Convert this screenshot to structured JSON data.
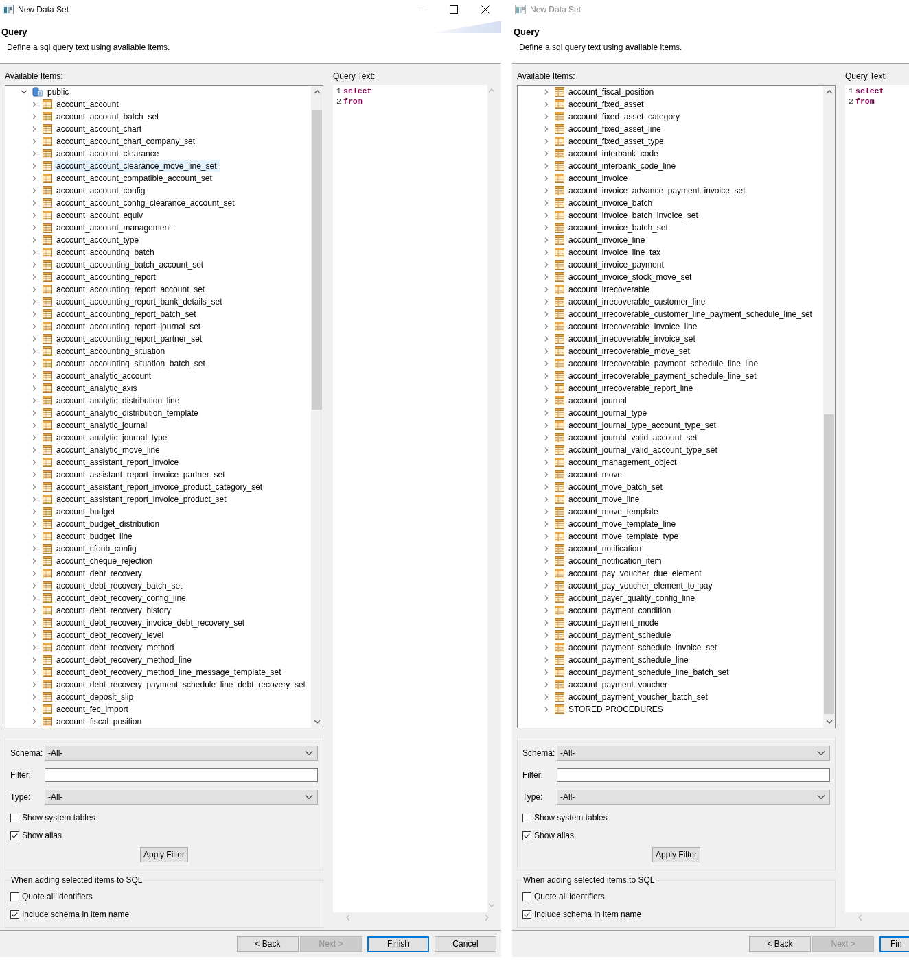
{
  "dialogs": [
    {
      "title": "New Data Set",
      "active": true,
      "window_controls": [
        {
          "kind": "minimize",
          "disabled": true
        },
        {
          "kind": "maximize",
          "disabled": false
        },
        {
          "kind": "close",
          "disabled": false
        }
      ],
      "header": {
        "title": "Query",
        "description": "Define a sql query text using available items."
      },
      "available_items_label": "Available Items:",
      "query_text_label": "Query Text:",
      "tree": [
        {
          "label": "public",
          "kind": "schema",
          "expanded": true,
          "selected": false,
          "children": [
            {
              "label": "account_account",
              "kind": "table",
              "expanded": false,
              "selected": false
            },
            {
              "label": "account_account_batch_set",
              "kind": "table",
              "expanded": false,
              "selected": false
            },
            {
              "label": "account_account_chart",
              "kind": "table",
              "expanded": false,
              "selected": false
            },
            {
              "label": "account_account_chart_company_set",
              "kind": "table",
              "expanded": false,
              "selected": false
            },
            {
              "label": "account_account_clearance",
              "kind": "table",
              "expanded": false,
              "selected": false
            },
            {
              "label": "account_account_clearance_move_line_set",
              "kind": "table",
              "expanded": false,
              "selected": true
            },
            {
              "label": "account_account_compatible_account_set",
              "kind": "table",
              "expanded": false,
              "selected": false
            },
            {
              "label": "account_account_config",
              "kind": "table",
              "expanded": false,
              "selected": false
            },
            {
              "label": "account_account_config_clearance_account_set",
              "kind": "table",
              "expanded": false,
              "selected": false
            },
            {
              "label": "account_account_equiv",
              "kind": "table",
              "expanded": false,
              "selected": false
            },
            {
              "label": "account_account_management",
              "kind": "table",
              "expanded": false,
              "selected": false
            },
            {
              "label": "account_account_type",
              "kind": "table",
              "expanded": false,
              "selected": false
            },
            {
              "label": "account_accounting_batch",
              "kind": "table",
              "expanded": false,
              "selected": false
            },
            {
              "label": "account_accounting_batch_account_set",
              "kind": "table",
              "expanded": false,
              "selected": false
            },
            {
              "label": "account_accounting_report",
              "kind": "table",
              "expanded": false,
              "selected": false
            },
            {
              "label": "account_accounting_report_account_set",
              "kind": "table",
              "expanded": false,
              "selected": false
            },
            {
              "label": "account_accounting_report_bank_details_set",
              "kind": "table",
              "expanded": false,
              "selected": false
            },
            {
              "label": "account_accounting_report_batch_set",
              "kind": "table",
              "expanded": false,
              "selected": false
            },
            {
              "label": "account_accounting_report_journal_set",
              "kind": "table",
              "expanded": false,
              "selected": false
            },
            {
              "label": "account_accounting_report_partner_set",
              "kind": "table",
              "expanded": false,
              "selected": false
            },
            {
              "label": "account_accounting_situation",
              "kind": "table",
              "expanded": false,
              "selected": false
            },
            {
              "label": "account_accounting_situation_batch_set",
              "kind": "table",
              "expanded": false,
              "selected": false
            },
            {
              "label": "account_analytic_account",
              "kind": "table",
              "expanded": false,
              "selected": false
            },
            {
              "label": "account_analytic_axis",
              "kind": "table",
              "expanded": false,
              "selected": false
            },
            {
              "label": "account_analytic_distribution_line",
              "kind": "table",
              "expanded": false,
              "selected": false
            },
            {
              "label": "account_analytic_distribution_template",
              "kind": "table",
              "expanded": false,
              "selected": false
            },
            {
              "label": "account_analytic_journal",
              "kind": "table",
              "expanded": false,
              "selected": false
            },
            {
              "label": "account_analytic_journal_type",
              "kind": "table",
              "expanded": false,
              "selected": false
            },
            {
              "label": "account_analytic_move_line",
              "kind": "table",
              "expanded": false,
              "selected": false
            },
            {
              "label": "account_assistant_report_invoice",
              "kind": "table",
              "expanded": false,
              "selected": false
            },
            {
              "label": "account_assistant_report_invoice_partner_set",
              "kind": "table",
              "expanded": false,
              "selected": false
            },
            {
              "label": "account_assistant_report_invoice_product_category_set",
              "kind": "table",
              "expanded": false,
              "selected": false
            },
            {
              "label": "account_assistant_report_invoice_product_set",
              "kind": "table",
              "expanded": false,
              "selected": false
            },
            {
              "label": "account_budget",
              "kind": "table",
              "expanded": false,
              "selected": false
            },
            {
              "label": "account_budget_distribution",
              "kind": "table",
              "expanded": false,
              "selected": false
            },
            {
              "label": "account_budget_line",
              "kind": "table",
              "expanded": false,
              "selected": false
            },
            {
              "label": "account_cfonb_config",
              "kind": "table",
              "expanded": false,
              "selected": false
            },
            {
              "label": "account_cheque_rejection",
              "kind": "table",
              "expanded": false,
              "selected": false
            },
            {
              "label": "account_debt_recovery",
              "kind": "table",
              "expanded": false,
              "selected": false
            },
            {
              "label": "account_debt_recovery_batch_set",
              "kind": "table",
              "expanded": false,
              "selected": false
            },
            {
              "label": "account_debt_recovery_config_line",
              "kind": "table",
              "expanded": false,
              "selected": false
            },
            {
              "label": "account_debt_recovery_history",
              "kind": "table",
              "expanded": false,
              "selected": false
            },
            {
              "label": "account_debt_recovery_invoice_debt_recovery_set",
              "kind": "table",
              "expanded": false,
              "selected": false
            },
            {
              "label": "account_debt_recovery_level",
              "kind": "table",
              "expanded": false,
              "selected": false
            },
            {
              "label": "account_debt_recovery_method",
              "kind": "table",
              "expanded": false,
              "selected": false
            },
            {
              "label": "account_debt_recovery_method_line",
              "kind": "table",
              "expanded": false,
              "selected": false
            },
            {
              "label": "account_debt_recovery_method_line_message_template_set",
              "kind": "table",
              "expanded": false,
              "selected": false
            },
            {
              "label": "account_debt_recovery_payment_schedule_line_debt_recovery_set",
              "kind": "table",
              "expanded": false,
              "selected": false
            },
            {
              "label": "account_deposit_slip",
              "kind": "table",
              "expanded": false,
              "selected": false
            },
            {
              "label": "account_fec_import",
              "kind": "table",
              "expanded": false,
              "selected": false
            },
            {
              "label": "account_fiscal_position",
              "kind": "table",
              "expanded": false,
              "selected": false
            }
          ]
        }
      ],
      "query_lines": [
        {
          "number": "1",
          "text": "select"
        },
        {
          "number": "2",
          "text": "from"
        }
      ],
      "schema": {
        "label": "Schema:",
        "value": "-All-"
      },
      "filter": {
        "label": "Filter:"
      },
      "type": {
        "label": "Type:",
        "value": "-All-"
      },
      "filter_options": [
        {
          "label": "Show system tables",
          "checked": false
        },
        {
          "label": "Show alias",
          "checked": true
        }
      ],
      "apply_button": "Apply Filter",
      "sql_group": {
        "title": "When adding selected items to SQL",
        "options": [
          {
            "label": "Quote all identifiers",
            "checked": false
          },
          {
            "label": "Include schema in item name",
            "checked": true
          }
        ]
      },
      "buttons": [
        {
          "label": "< Back",
          "disabled": false,
          "default": false,
          "cut": false
        },
        {
          "label": "Next >",
          "disabled": true,
          "default": false,
          "cut": false
        },
        {
          "label": "Finish",
          "disabled": false,
          "default": true,
          "cut": false
        },
        {
          "label": "Cancel",
          "disabled": false,
          "default": false,
          "cut": false
        }
      ]
    },
    {
      "title": "New Data Set",
      "active": false,
      "header": {
        "title": "Query",
        "description": "Define a sql query text using available items."
      },
      "available_items_label": "Available Items:",
      "query_text_label": "Query Text:",
      "tree": [
        {
          "label": "account_fiscal_position",
          "kind": "table",
          "expanded": false,
          "selected": false
        },
        {
          "label": "account_fixed_asset",
          "kind": "table",
          "expanded": false,
          "selected": false
        },
        {
          "label": "account_fixed_asset_category",
          "kind": "table",
          "expanded": false,
          "selected": false
        },
        {
          "label": "account_fixed_asset_line",
          "kind": "table",
          "expanded": false,
          "selected": false
        },
        {
          "label": "account_fixed_asset_type",
          "kind": "table",
          "expanded": false,
          "selected": false
        },
        {
          "label": "account_interbank_code",
          "kind": "table",
          "expanded": false,
          "selected": false
        },
        {
          "label": "account_interbank_code_line",
          "kind": "table",
          "expanded": false,
          "selected": false
        },
        {
          "label": "account_invoice",
          "kind": "table",
          "expanded": false,
          "selected": false
        },
        {
          "label": "account_invoice_advance_payment_invoice_set",
          "kind": "table",
          "expanded": false,
          "selected": false
        },
        {
          "label": "account_invoice_batch",
          "kind": "table",
          "expanded": false,
          "selected": false
        },
        {
          "label": "account_invoice_batch_invoice_set",
          "kind": "table",
          "expanded": false,
          "selected": false
        },
        {
          "label": "account_invoice_batch_set",
          "kind": "table",
          "expanded": false,
          "selected": false
        },
        {
          "label": "account_invoice_line",
          "kind": "table",
          "expanded": false,
          "selected": false
        },
        {
          "label": "account_invoice_line_tax",
          "kind": "table",
          "expanded": false,
          "selected": false
        },
        {
          "label": "account_invoice_payment",
          "kind": "table",
          "expanded": false,
          "selected": false
        },
        {
          "label": "account_invoice_stock_move_set",
          "kind": "table",
          "expanded": false,
          "selected": false
        },
        {
          "label": "account_irrecoverable",
          "kind": "table",
          "expanded": false,
          "selected": false
        },
        {
          "label": "account_irrecoverable_customer_line",
          "kind": "table",
          "expanded": false,
          "selected": false
        },
        {
          "label": "account_irrecoverable_customer_line_payment_schedule_line_set",
          "kind": "table",
          "expanded": false,
          "selected": false
        },
        {
          "label": "account_irrecoverable_invoice_line",
          "kind": "table",
          "expanded": false,
          "selected": false
        },
        {
          "label": "account_irrecoverable_invoice_set",
          "kind": "table",
          "expanded": false,
          "selected": false
        },
        {
          "label": "account_irrecoverable_move_set",
          "kind": "table",
          "expanded": false,
          "selected": false
        },
        {
          "label": "account_irrecoverable_payment_schedule_line_line",
          "kind": "table",
          "expanded": false,
          "selected": false
        },
        {
          "label": "account_irrecoverable_payment_schedule_line_set",
          "kind": "table",
          "expanded": false,
          "selected": false
        },
        {
          "label": "account_irrecoverable_report_line",
          "kind": "table",
          "expanded": false,
          "selected": false
        },
        {
          "label": "account_journal",
          "kind": "table",
          "expanded": false,
          "selected": false
        },
        {
          "label": "account_journal_type",
          "kind": "table",
          "expanded": false,
          "selected": false
        },
        {
          "label": "account_journal_type_account_type_set",
          "kind": "table",
          "expanded": false,
          "selected": false
        },
        {
          "label": "account_journal_valid_account_set",
          "kind": "table",
          "expanded": false,
          "selected": false
        },
        {
          "label": "account_journal_valid_account_type_set",
          "kind": "table",
          "expanded": false,
          "selected": false
        },
        {
          "label": "account_management_object",
          "kind": "table",
          "expanded": false,
          "selected": false
        },
        {
          "label": "account_move",
          "kind": "table",
          "expanded": false,
          "selected": false
        },
        {
          "label": "account_move_batch_set",
          "kind": "table",
          "expanded": false,
          "selected": false
        },
        {
          "label": "account_move_line",
          "kind": "table",
          "expanded": false,
          "selected": false
        },
        {
          "label": "account_move_template",
          "kind": "table",
          "expanded": false,
          "selected": false
        },
        {
          "label": "account_move_template_line",
          "kind": "table",
          "expanded": false,
          "selected": false
        },
        {
          "label": "account_move_template_type",
          "kind": "table",
          "expanded": false,
          "selected": false
        },
        {
          "label": "account_notification",
          "kind": "table",
          "expanded": false,
          "selected": false
        },
        {
          "label": "account_notification_item",
          "kind": "table",
          "expanded": false,
          "selected": false
        },
        {
          "label": "account_pay_voucher_due_element",
          "kind": "table",
          "expanded": false,
          "selected": false
        },
        {
          "label": "account_pay_voucher_element_to_pay",
          "kind": "table",
          "expanded": false,
          "selected": false
        },
        {
          "label": "account_payer_quality_config_line",
          "kind": "table",
          "expanded": false,
          "selected": false
        },
        {
          "label": "account_payment_condition",
          "kind": "table",
          "expanded": false,
          "selected": false
        },
        {
          "label": "account_payment_mode",
          "kind": "table",
          "expanded": false,
          "selected": false
        },
        {
          "label": "account_payment_schedule",
          "kind": "table",
          "expanded": false,
          "selected": false
        },
        {
          "label": "account_payment_schedule_invoice_set",
          "kind": "table",
          "expanded": false,
          "selected": false
        },
        {
          "label": "account_payment_schedule_line",
          "kind": "table",
          "expanded": false,
          "selected": false
        },
        {
          "label": "account_payment_schedule_line_batch_set",
          "kind": "table",
          "expanded": false,
          "selected": false
        },
        {
          "label": "account_payment_voucher",
          "kind": "table",
          "expanded": false,
          "selected": false
        },
        {
          "label": "account_payment_voucher_batch_set",
          "kind": "table",
          "expanded": false,
          "selected": false
        },
        {
          "label": "STORED PROCEDURES",
          "kind": "table",
          "expanded": false,
          "selected": false
        }
      ],
      "query_lines": [
        {
          "number": "1",
          "text": "select"
        },
        {
          "number": "2",
          "text": "from"
        }
      ],
      "schema": {
        "label": "Schema:",
        "value": "-All-"
      },
      "filter": {
        "label": "Filter:"
      },
      "type": {
        "label": "Type:",
        "value": "-All-"
      },
      "filter_options": [
        {
          "label": "Show system tables",
          "checked": false
        },
        {
          "label": "Show alias",
          "checked": true
        }
      ],
      "apply_button": "Apply Filter",
      "sql_group": {
        "title": "When adding selected items to SQL",
        "options": [
          {
            "label": "Quote all identifiers",
            "checked": false
          },
          {
            "label": "Include schema in item name",
            "checked": true
          }
        ]
      },
      "buttons": [
        {
          "label": "< Back",
          "disabled": false,
          "default": false,
          "cut": false
        },
        {
          "label": "Next >",
          "disabled": true,
          "default": false,
          "cut": false
        },
        {
          "label": "Fin",
          "disabled": false,
          "default": true,
          "cut": true
        }
      ]
    }
  ]
}
